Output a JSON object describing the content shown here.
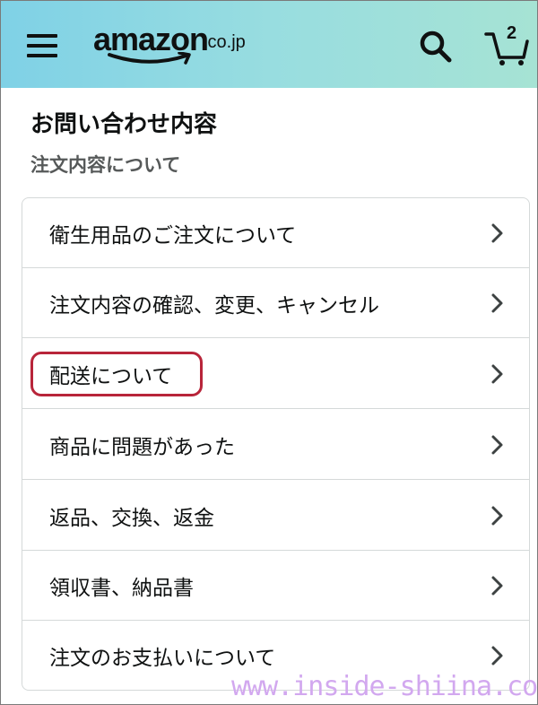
{
  "header": {
    "logo_text": "amazon",
    "logo_suffix": ".co.jp",
    "cart_count": "2",
    "icons": {
      "menu": "hamburger-menu-icon",
      "search": "search-icon",
      "cart": "cart-icon"
    }
  },
  "page": {
    "title": "お問い合わせ内容",
    "subtitle": "注文内容について"
  },
  "menu_items": [
    {
      "label": "衛生用品のご注文について"
    },
    {
      "label": "注文内容の確認、変更、キャンセル"
    },
    {
      "label": "配送について"
    },
    {
      "label": "商品に問題があった"
    },
    {
      "label": "返品、交換、返金"
    },
    {
      "label": "領収書、納品書"
    },
    {
      "label": "注文のお支払いについて"
    }
  ],
  "highlighted_item": "配送について",
  "watermark": "www.inside-shiina.com",
  "colors": {
    "header_gradient_start": "#7fd1e6",
    "header_gradient_end": "#a6e3d4",
    "highlight_border": "#b8253a",
    "watermark": "#d2a8ef",
    "subtitle": "#565959"
  }
}
